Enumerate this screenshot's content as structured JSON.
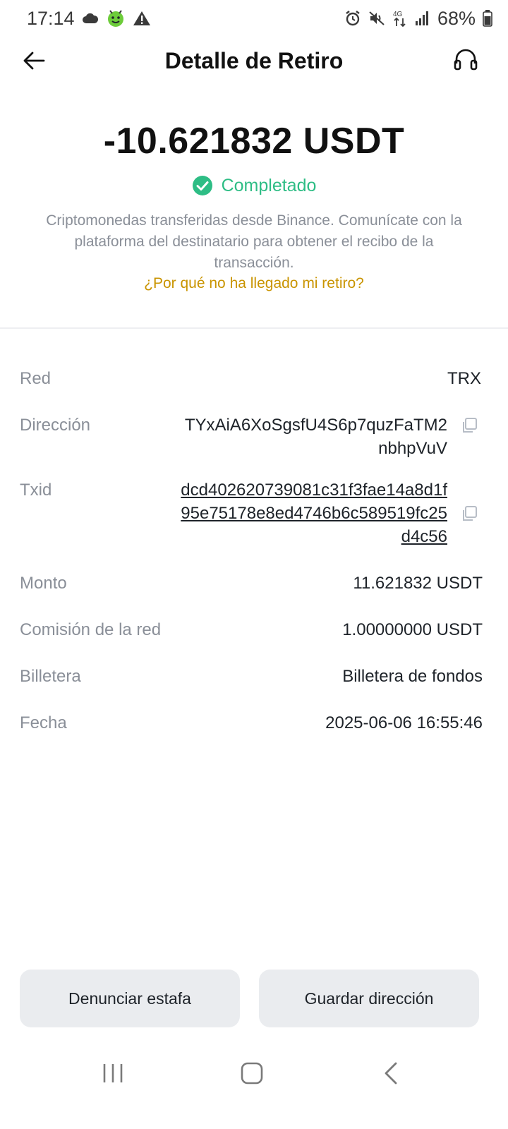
{
  "status_bar": {
    "time": "17:14",
    "battery": "68%",
    "network": "4G"
  },
  "header": {
    "title": "Detalle de Retiro"
  },
  "summary": {
    "amount": "-10.621832 USDT",
    "status": "Completado",
    "description": "Criptomonedas transferidas desde Binance. Comunícate con la plataforma del destinatario para obtener el recibo de la transacción.",
    "help_link": "¿Por qué no ha llegado mi retiro?"
  },
  "details": {
    "network": {
      "label": "Red",
      "value": "TRX"
    },
    "address": {
      "label": "Dirección",
      "value": "TYxAiA6XoSgsfU4S6p7quzFaTM2nbhpVuV"
    },
    "txid": {
      "label": "Txid",
      "value": "dcd402620739081c31f3fae14a8d1f95e75178e8ed4746b6c589519fc25d4c56"
    },
    "amount": {
      "label": "Monto",
      "value": "11.621832 USDT"
    },
    "fee": {
      "label": "Comisión de la red",
      "value": "1.00000000 USDT"
    },
    "wallet": {
      "label": "Billetera",
      "value": "Billetera de fondos"
    },
    "date": {
      "label": "Fecha",
      "value": "2025-06-06 16:55:46"
    }
  },
  "buttons": {
    "report": "Denunciar estafa",
    "save_address": "Guardar dirección"
  },
  "colors": {
    "success": "#2ebd85",
    "link": "#c99400",
    "label": "#8a8f98",
    "button_bg": "#eaecef"
  }
}
